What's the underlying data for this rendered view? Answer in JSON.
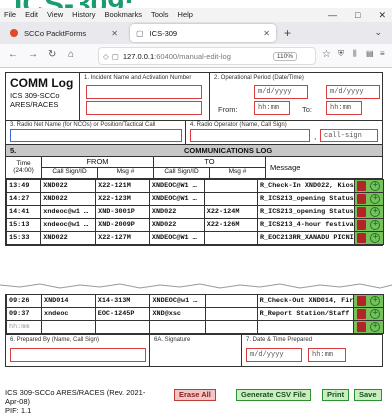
{
  "banner": {
    "text": "ICS-309:"
  },
  "menubar": {
    "items": [
      "File",
      "Edit",
      "View",
      "History",
      "Bookmarks",
      "Tools",
      "Help"
    ]
  },
  "window_controls": {
    "minimize": "—",
    "maximize": "□",
    "close": "✕"
  },
  "tabs": [
    {
      "title": "SCCo PacktForms",
      "icon": "red-circle-favicon"
    },
    {
      "title": "ICS-309",
      "icon": "page-icon"
    }
  ],
  "nav": {
    "host": "127.0.0.1",
    "path": ":60400/manual-edit-log",
    "zoom": "110%"
  },
  "form": {
    "title": "COMM Log",
    "subtitle1": "ICS 309-SCCo",
    "subtitle2": "ARES/RACES",
    "l1": "1. Incident Name and Activation Number",
    "l2": "2. Operational Period (Date/Time)",
    "from_label": "From:",
    "to_label": "To:",
    "ph_date": "m/d/yyyy",
    "ph_time": "hh:mm",
    "l3": "3. Radio Net Name (for NCOs) or Position/Tactical Call",
    "l4": "4. Radio Operator (Name, Call Sign)",
    "callsign_ph": "call-sign",
    "sec_num": "5.",
    "sec_title": "COMMUNICATIONS LOG",
    "col_time": "Time\n(24:00)",
    "col_from": "FROM",
    "col_to": "TO",
    "col_callsign": "Call Sign/ID",
    "col_msg": "Msg #",
    "col_message": "Message",
    "rows_top": [
      {
        "time": "13:49",
        "from_cs": "XND022",
        "from_msg": "X22-121M",
        "to_cs": "XNDEOC@W1 …",
        "to_msg": "",
        "message": "R_Check-In XND022, Kios"
      },
      {
        "time": "14:27",
        "from_cs": "XND022",
        "from_msg": "X22-123M",
        "to_cs": "XNDEOC@W1 …",
        "to_msg": "",
        "message": "R_ICS213_opening Status"
      },
      {
        "time": "14:41",
        "from_cs": "xndeoc@w1 …",
        "from_msg": "XND-3001P",
        "to_cs": "XND022",
        "to_msg": "X22-124M",
        "message": "R_ICS213_opening Status"
      },
      {
        "time": "15:13",
        "from_cs": "xndeoc@w1 …",
        "from_msg": "XND-2009P",
        "to_cs": "XND022",
        "to_msg": "X22-126M",
        "message": "R_ICS213_4-hour festiva"
      },
      {
        "time": "15:33",
        "from_cs": "XND022",
        "from_msg": "X22-127M",
        "to_cs": "XNDEOC@W1 …",
        "to_msg": "",
        "message": "R_EOC213RR_XANADU PICNI"
      }
    ],
    "rows_bottom": [
      {
        "time": "09:26",
        "from_cs": "XND014",
        "from_msg": "X14-313M",
        "to_cs": "XNDEOC@w1 …",
        "to_msg": "",
        "message": "R_Check-Out XND014, Fir"
      },
      {
        "time": "09:37",
        "from_cs": "xndeoc",
        "from_msg": "EOC-1245P",
        "to_cs": "XND@xsc",
        "to_msg": "",
        "message": "R_Report Station/Staff"
      },
      {
        "time": "hh:mm",
        "from_cs": "",
        "from_msg": "",
        "to_cs": "",
        "to_msg": "",
        "message": ""
      }
    ],
    "l6": "6. Prepared By (Name, Call Sign)",
    "l6a": "6A. Signature",
    "l7": "7. Date & Time Prepared"
  },
  "footer": {
    "info_line1": "ICS 309-SCCo ARES/RACES (Rev. 2021-",
    "info_line2": "Apr-08)",
    "info_line3": "PIF: 1.1",
    "erase_all": "Erase All",
    "generate_csv": "Generate CSV File",
    "print": "Print",
    "save": "Save"
  }
}
